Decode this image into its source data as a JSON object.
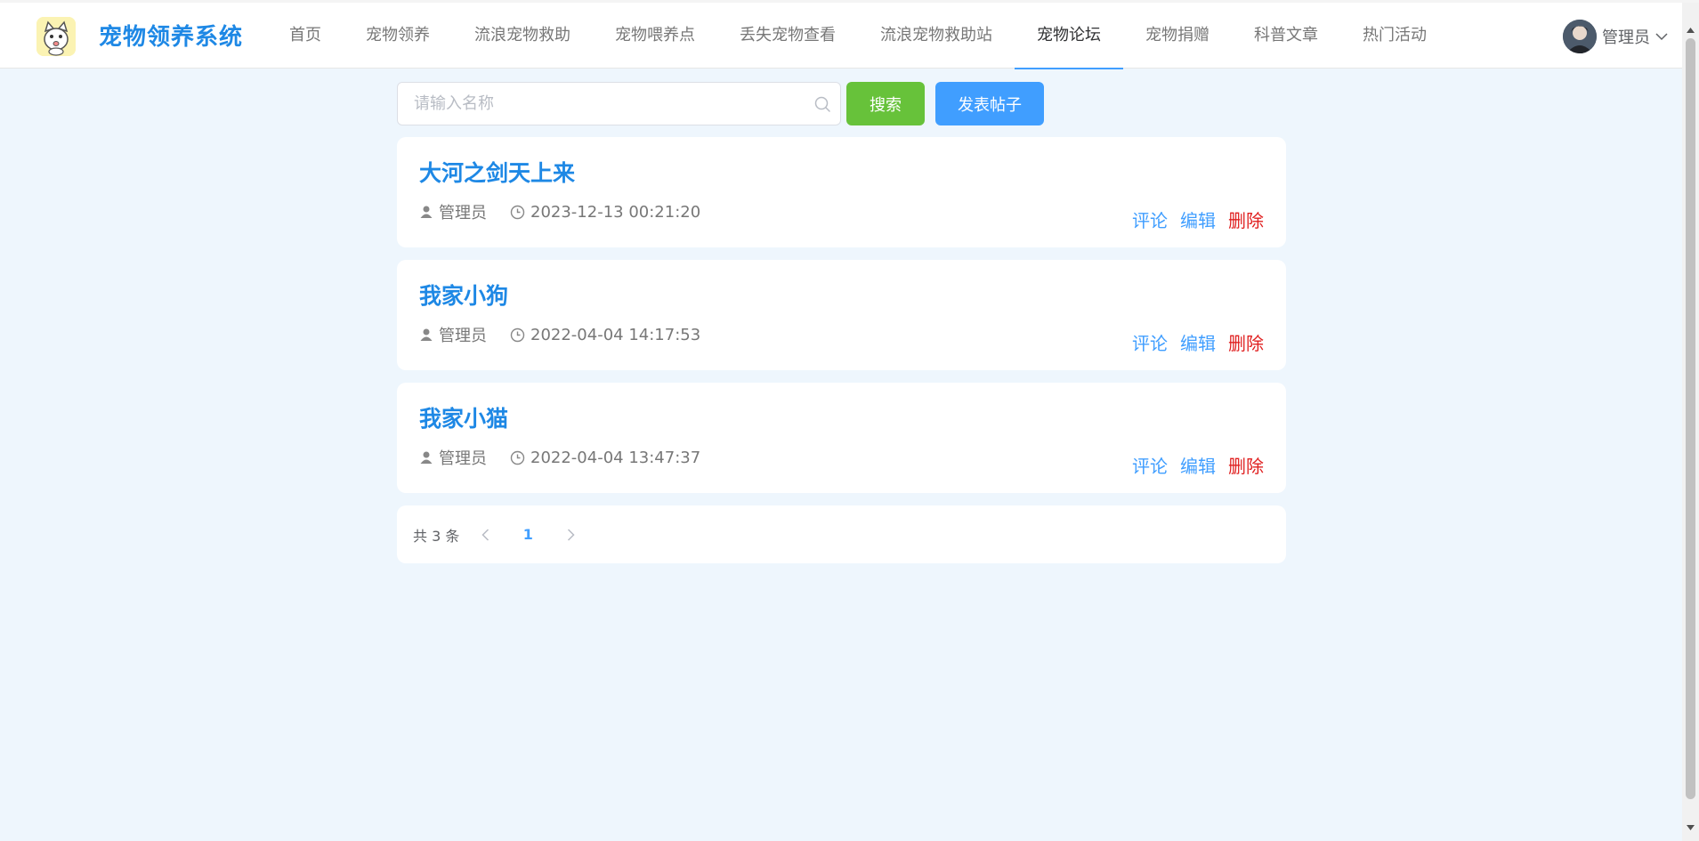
{
  "header": {
    "brand": "宠物领养系统",
    "nav": [
      {
        "label": "首页",
        "active": false
      },
      {
        "label": "宠物领养",
        "active": false
      },
      {
        "label": "流浪宠物救助",
        "active": false
      },
      {
        "label": "宠物喂养点",
        "active": false
      },
      {
        "label": "丢失宠物查看",
        "active": false
      },
      {
        "label": "流浪宠物救助站",
        "active": false
      },
      {
        "label": "宠物论坛",
        "active": true
      },
      {
        "label": "宠物捐赠",
        "active": false
      },
      {
        "label": "科普文章",
        "active": false
      },
      {
        "label": "热门活动",
        "active": false
      }
    ],
    "user_name": "管理员"
  },
  "search": {
    "placeholder": "请输入名称",
    "value": "",
    "search_label": "搜索",
    "post_label": "发表帖子"
  },
  "posts": [
    {
      "title": "大河之剑天上来",
      "author": "管理员",
      "time": "2023-12-13 00:21:20"
    },
    {
      "title": "我家小狗",
      "author": "管理员",
      "time": "2022-04-04 14:17:53"
    },
    {
      "title": "我家小猫",
      "author": "管理员",
      "time": "2022-04-04 13:47:37"
    }
  ],
  "actions": {
    "comment": "评论",
    "edit": "编辑",
    "delete": "删除"
  },
  "pagination": {
    "total_text": "共 3 条",
    "current_page": "1"
  },
  "colors": {
    "accent": "#409eff",
    "success": "#67c23a",
    "danger": "#e02020",
    "brand": "#1e88e5",
    "background": "#eef6fd"
  }
}
